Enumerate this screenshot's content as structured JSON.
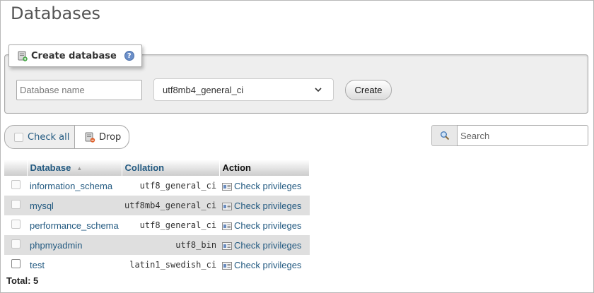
{
  "page": {
    "title": "Databases"
  },
  "create": {
    "legend": "Create database",
    "name_placeholder": "Database name",
    "collation_value": "utf8mb4_general_ci",
    "create_label": "Create"
  },
  "toolbar": {
    "check_all_label": "Check all",
    "drop_label": "Drop",
    "search_placeholder": "Search"
  },
  "table": {
    "headers": {
      "database": "Database",
      "collation": "Collation",
      "action": "Action"
    },
    "rows": [
      {
        "name": "information_schema",
        "collation": "utf8_general_ci",
        "action": "Check privileges"
      },
      {
        "name": "mysql",
        "collation": "utf8mb4_general_ci",
        "action": "Check privileges"
      },
      {
        "name": "performance_schema",
        "collation": "utf8_general_ci",
        "action": "Check privileges"
      },
      {
        "name": "phpmyadmin",
        "collation": "utf8_bin",
        "action": "Check privileges"
      },
      {
        "name": "test",
        "collation": "latin1_swedish_ci",
        "action": "Check privileges"
      }
    ]
  },
  "footer": {
    "total": "Total: 5"
  },
  "icons": {
    "create_db": "database-add-icon",
    "help": "help-icon",
    "drop": "database-drop-icon",
    "search": "search-icon",
    "privileges": "privileges-icon",
    "sort": "sort-ascending-icon",
    "dropdown": "chevron-down-icon"
  },
  "colors": {
    "link": "#235a81",
    "panel_bg": "#eeeeee",
    "row_alt": "#dfdfdf"
  }
}
